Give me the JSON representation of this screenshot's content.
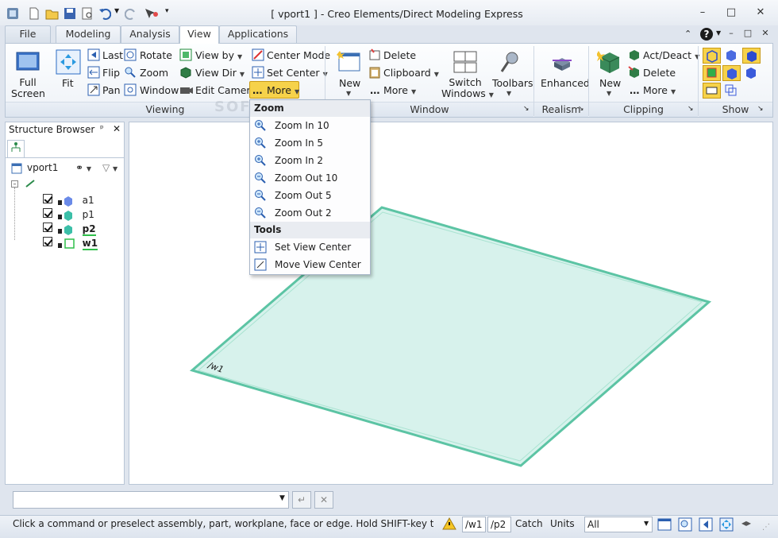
{
  "window": {
    "title": "[ vport1 ] - Creo Elements/Direct Modeling Express",
    "minimize": "–",
    "restore": "□",
    "close": "✕"
  },
  "tabs": [
    {
      "label": "File"
    },
    {
      "label": "Modeling"
    },
    {
      "label": "Analysis"
    },
    {
      "label": "View"
    },
    {
      "label": "Applications"
    }
  ],
  "ribbon": {
    "viewing": {
      "full_screen": [
        "Full",
        "Screen"
      ],
      "fit": "Fit",
      "last": "Last",
      "flip": "Flip",
      "pan": "Pan",
      "rotate": "Rotate",
      "zoom": "Zoom",
      "window": "Window",
      "view_by": "View by",
      "view_dir": "View Dir",
      "edit_camera": "Edit Camera",
      "center_mode": "Center Mode",
      "set_center": "Set Center",
      "more": "More",
      "group": "Viewing"
    },
    "window": {
      "new": "New",
      "delete": "Delete",
      "clipboard": "Clipboard",
      "more": "More",
      "switch_windows": [
        "Switch",
        "Windows"
      ],
      "toolbars": "Toolbars",
      "group": "Window"
    },
    "realism": {
      "enhanced": "Enhanced",
      "group": "Realism"
    },
    "clipping": {
      "new": "New",
      "act_deact": "Act/Deact",
      "delete": "Delete",
      "more": "More",
      "group": "Clipping"
    },
    "show": {
      "group": "Show"
    }
  },
  "more_menu": {
    "zoom_header": "Zoom",
    "zoom_items": [
      "Zoom In 10",
      "Zoom In 5",
      "Zoom In 2",
      "Zoom Out 10",
      "Zoom Out 5",
      "Zoom Out 2"
    ],
    "tools_header": "Tools",
    "tools_items": [
      "Set View Center",
      "Move View Center"
    ]
  },
  "structure_browser": {
    "title": "Structure Browser",
    "pin": "ᵖ",
    "close": "✕",
    "viewport": "vport1",
    "items": [
      {
        "label": "a1"
      },
      {
        "label": "p1"
      },
      {
        "label": "p2"
      },
      {
        "label": "w1"
      }
    ]
  },
  "viewport": {
    "workplane_label": "/w1"
  },
  "watermark": "SOFTPEDIA",
  "status": {
    "message": "Click a command or preselect assembly, part, workplane, face or edge. Hold SHIFT-key to select m...",
    "workplane": "/w1",
    "part": "/p2",
    "catch": "Catch",
    "units": "Units",
    "filter": "All"
  },
  "colors": {
    "accent": "#2b6cc4",
    "workplane_fill": "#d7f2ec",
    "workplane_edge": "#5cc4a4",
    "highlight": "#f6d24a"
  }
}
